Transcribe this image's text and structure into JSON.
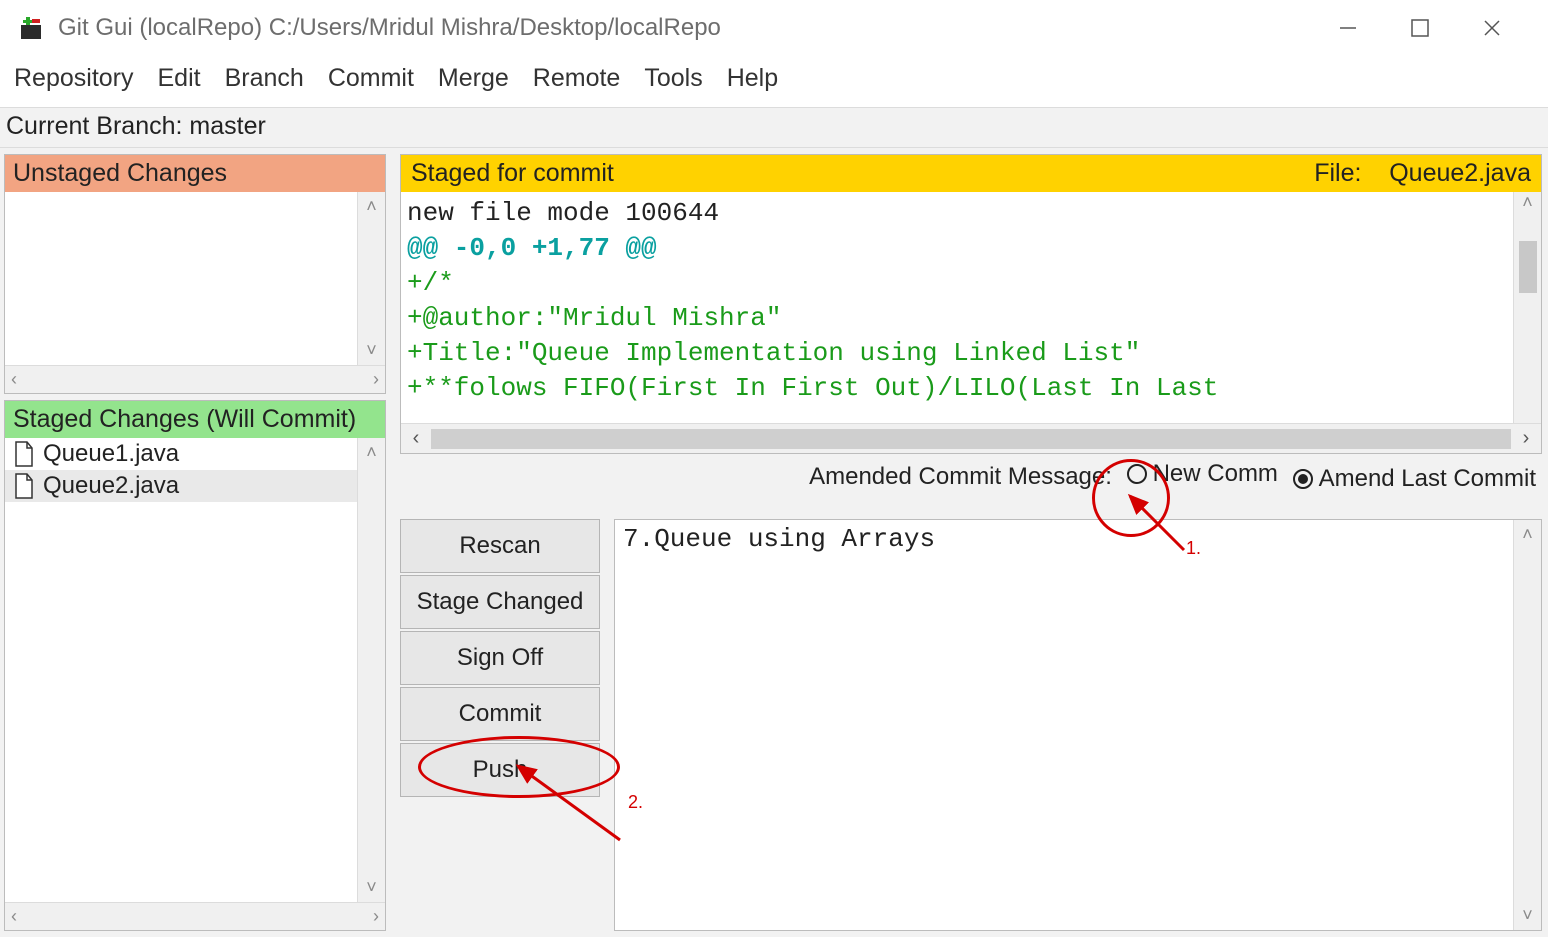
{
  "window": {
    "title": "Git Gui (localRepo) C:/Users/Mridul Mishra/Desktop/localRepo"
  },
  "menu": {
    "items": [
      "Repository",
      "Edit",
      "Branch",
      "Commit",
      "Merge",
      "Remote",
      "Tools",
      "Help"
    ]
  },
  "branchbar": {
    "label": "Current Branch: master"
  },
  "left": {
    "unstaged_header": "Unstaged Changes",
    "staged_header": "Staged Changes (Will Commit)",
    "staged_files": [
      "Queue1.java",
      "Queue2.java"
    ],
    "staged_selected_index": 1
  },
  "diff": {
    "header_left": "Staged for commit",
    "header_file_label": "File:",
    "header_file_name": "Queue2.java",
    "line_mode": "new file mode 100644",
    "line_hunk": "@@ -0,0 +1,77 @@",
    "line_add1": "+/*",
    "line_add2": "+@author:\"Mridul Mishra\"",
    "line_add3": "+Title:\"Queue Implementation using Linked List\"",
    "line_add4": "+**folows FIFO(First In First Out)/LILO(Last In Last"
  },
  "commit": {
    "options_label": "Amended Commit Message:",
    "radio_new": "New Comm",
    "radio_amend": "Amend Last Commit",
    "amend_selected": true,
    "buttons": {
      "rescan": "Rescan",
      "stage_changed": "Stage Changed",
      "sign_off": "Sign Off",
      "commit": "Commit",
      "push": "Push"
    },
    "message": "7.Queue using Arrays"
  },
  "annotations": {
    "label1": "1.",
    "label2": "2."
  }
}
